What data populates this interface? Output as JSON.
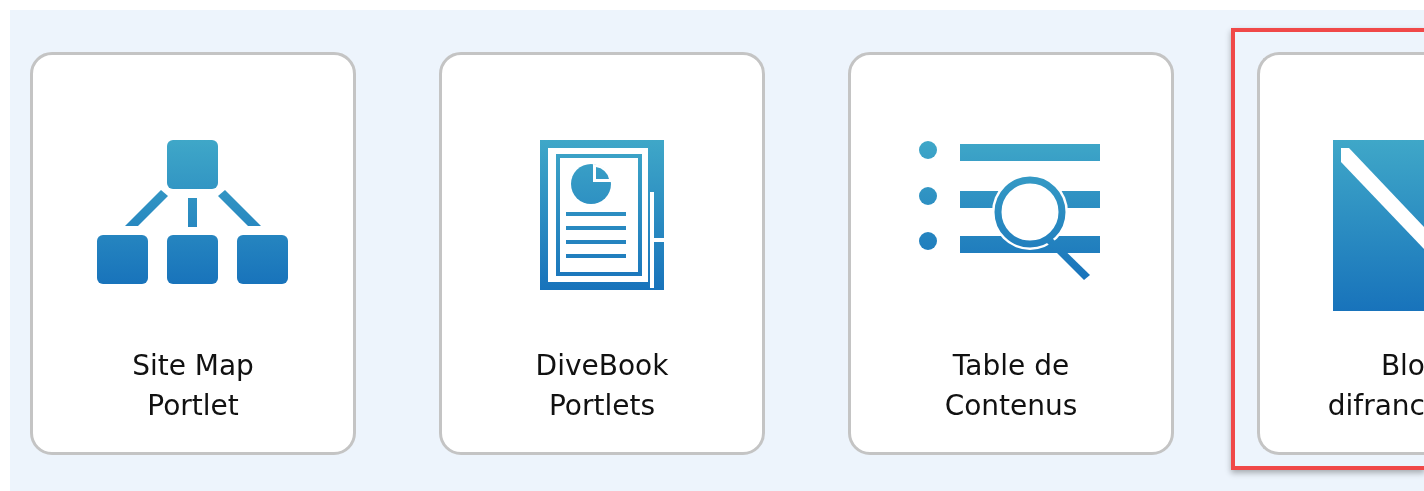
{
  "cards": [
    {
      "kind": "sitemap",
      "lines": [
        "Site Map",
        "Portlet"
      ],
      "highlighted": false,
      "clipped": false
    },
    {
      "kind": "document",
      "lines": [
        "DiveBook",
        "Portlets"
      ],
      "highlighted": false,
      "clipped": false
    },
    {
      "kind": "toc",
      "lines": [
        "Table de",
        "Contenus"
      ],
      "highlighted": false,
      "clipped": false
    },
    {
      "kind": "block",
      "lines": [
        "Blo",
        "difranc"
      ],
      "highlighted": true,
      "clipped": true
    }
  ]
}
